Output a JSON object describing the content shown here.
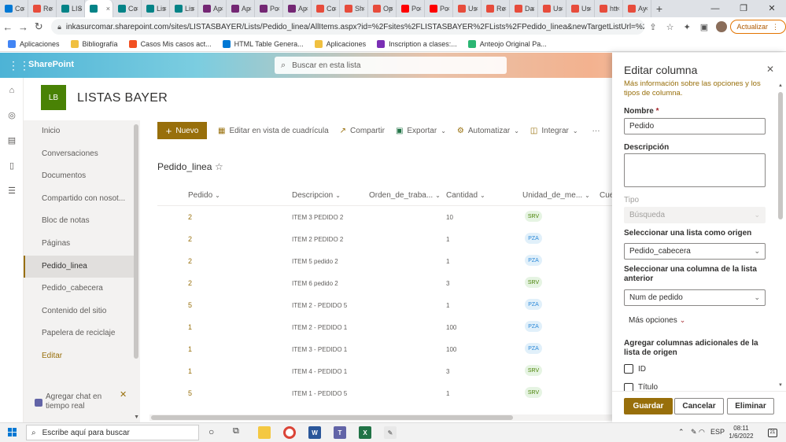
{
  "browser": {
    "tabs": [
      {
        "label": "Co",
        "color": "#0078d4"
      },
      {
        "label": "Re",
        "color": "#e74c3c"
      },
      {
        "label": "LIS",
        "color": "#038387"
      },
      {
        "label": "",
        "color": "#038387"
      },
      {
        "label": "Co",
        "color": "#038387"
      },
      {
        "label": "Lis",
        "color": "#038387"
      },
      {
        "label": "Lis",
        "color": "#038387"
      },
      {
        "label": "Ap",
        "color": "#742774"
      },
      {
        "label": "Ap",
        "color": "#742774"
      },
      {
        "label": "Po",
        "color": "#742774"
      },
      {
        "label": "Ap",
        "color": "#742774"
      },
      {
        "label": "Co",
        "color": "#e74c3c"
      },
      {
        "label": "Sh",
        "color": "#e74c3c"
      },
      {
        "label": "Op",
        "color": "#e74c3c"
      },
      {
        "label": "Po",
        "color": "#ff0000"
      },
      {
        "label": "Po",
        "color": "#ff0000"
      },
      {
        "label": "Us",
        "color": "#e74c3c"
      },
      {
        "label": "Re",
        "color": "#e74c3c"
      },
      {
        "label": "Da",
        "color": "#e74c3c"
      },
      {
        "label": "Us",
        "color": "#e74c3c"
      },
      {
        "label": "Us",
        "color": "#e74c3c"
      },
      {
        "label": "htt",
        "color": "#e74c3c"
      },
      {
        "label": "Ay",
        "color": "#e74c3c"
      }
    ],
    "active_tab_index": 3,
    "url": "inkasurcomar.sharepoint.com/sites/LISTASBAYER/Lists/Pedido_linea/AllItems.aspx?id=%2Fsites%2FLISTASBAYER%2FLists%2FPedido_linea&newTargetListUrl=%2Fsites%2FLISTASBA...",
    "update_label": "Actualizar",
    "bookmarks": [
      {
        "label": "Aplicaciones",
        "color": "#4285f4"
      },
      {
        "label": "Bibliografía",
        "color": "#f0c040"
      },
      {
        "label": "Casos Mis casos act...",
        "color": "#f25022"
      },
      {
        "label": "HTML Table Genera...",
        "color": "#0078d4"
      },
      {
        "label": "Aplicaciones",
        "color": "#f0c040"
      },
      {
        "label": "Inscription a clases:...",
        "color": "#7b2fb5"
      },
      {
        "label": "Anteojo Original Pa...",
        "color": "#2bb673"
      }
    ]
  },
  "suite": {
    "brand": "SharePoint",
    "search_placeholder": "Buscar en esta lista"
  },
  "site": {
    "logo": "LB",
    "title": "LISTAS BAYER"
  },
  "nav": {
    "items": [
      "Inicio",
      "Conversaciones",
      "Documentos",
      "Compartido con nosot...",
      "Bloc de notas",
      "Páginas",
      "Pedido_linea",
      "Pedido_cabecera",
      "Contenido del sitio",
      "Papelera de reciclaje",
      "Editar"
    ],
    "active_index": 6,
    "chat_text": "Agregar chat en tiempo real"
  },
  "commands": {
    "new": "Nuevo",
    "grid_edit": "Editar en vista de cuadrícula",
    "share": "Compartir",
    "export": "Exportar",
    "automate": "Automatizar",
    "integrate": "Integrar",
    "more": "···"
  },
  "list": {
    "title": "Pedido_linea",
    "columns": [
      "Pedido",
      "Descripcion",
      "Orden_de_traba...",
      "Cantidad",
      "Unidad_de_me...",
      "Cue"
    ],
    "rows": [
      {
        "pedido": "2",
        "descripcion": "ITEM 3 PEDIDO 2",
        "cantidad": "10",
        "unidad": "SRV"
      },
      {
        "pedido": "2",
        "descripcion": "ITEM 2 PEDIDO 2",
        "cantidad": "1",
        "unidad": "PZA"
      },
      {
        "pedido": "2",
        "descripcion": "ITEM 5 pedido 2",
        "cantidad": "1",
        "unidad": "PZA"
      },
      {
        "pedido": "2",
        "descripcion": "ITEM 6 pedido 2",
        "cantidad": "3",
        "unidad": "SRV"
      },
      {
        "pedido": "5",
        "descripcion": "ITEM 2 - PEDIDO 5",
        "cantidad": "1",
        "unidad": "PZA"
      },
      {
        "pedido": "1",
        "descripcion": "ITEM 2 - PEDIDO 1",
        "cantidad": "100",
        "unidad": "PZA"
      },
      {
        "pedido": "1",
        "descripcion": "ITEM 3 - PEDIDO 1",
        "cantidad": "100",
        "unidad": "PZA"
      },
      {
        "pedido": "1",
        "descripcion": "ITEM 4 - PEDIDO 1",
        "cantidad": "3",
        "unidad": "SRV"
      },
      {
        "pedido": "5",
        "descripcion": "ITEM 1 - PEDIDO 5",
        "cantidad": "1",
        "unidad": "SRV"
      }
    ]
  },
  "panel": {
    "title": "Editar columna",
    "info": "Más información sobre las opciones y los tipos de columna.",
    "name_label": "Nombre",
    "name_required": "*",
    "name_value": "Pedido",
    "desc_label": "Descripción",
    "desc_value": "",
    "type_label": "Tipo",
    "type_value": "Búsqueda",
    "source_list_label": "Seleccionar una lista como origen",
    "source_list_value": "Pedido_cabecera",
    "source_col_label": "Seleccionar una columna de la lista anterior",
    "source_col_value": "Num de pedido",
    "more_options": "Más opciones",
    "extra_cols_label": "Agregar columnas adicionales de la lista de origen",
    "extra_cols": [
      "ID",
      "Título"
    ],
    "save": "Guardar",
    "cancel": "Cancelar",
    "delete": "Eliminar"
  },
  "taskbar": {
    "search_placeholder": "Escribe aquí para buscar",
    "language": "ESP",
    "time": "08:11",
    "date": "1/6/2022",
    "notifications": "21"
  }
}
